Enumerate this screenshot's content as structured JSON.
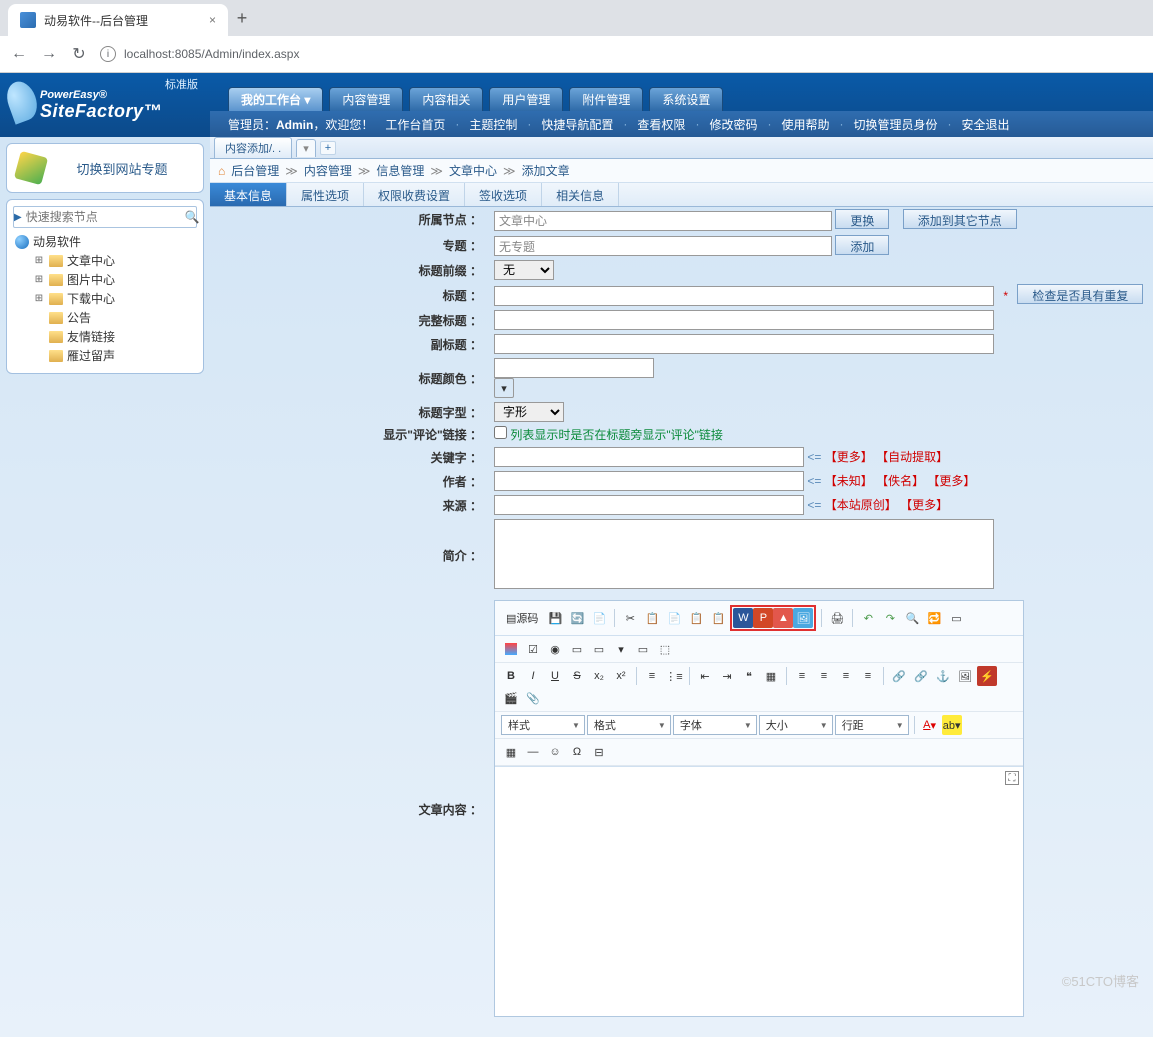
{
  "browser": {
    "tab_title": "动易软件--后台管理",
    "url": "localhost:8085/Admin/index.aspx"
  },
  "header": {
    "std_label": "标准版",
    "brand1": "PowerEasy®",
    "brand2": "SiteFactory™",
    "menu": [
      "我的工作台 ▾",
      "内容管理",
      "内容相关",
      "用户管理",
      "附件管理",
      "系统设置"
    ],
    "admin_prefix": "管理员：",
    "admin_name": "Admin",
    "welcome": "，欢迎您！",
    "links": [
      "工作台首页",
      "主题控制",
      "快捷导航配置",
      "查看权限",
      "修改密码",
      "使用帮助",
      "切换管理员身份",
      "安全退出"
    ]
  },
  "sidebar": {
    "switch_title": "切换到网站专题",
    "search_placeholder": "快速搜索节点",
    "root": "动易软件",
    "nodes": [
      "文章中心",
      "图片中心",
      "下载中心",
      "公告",
      "友情链接",
      "雁过留声"
    ]
  },
  "doc_tabs": {
    "active": "内容添加/. .",
    "add": "+"
  },
  "breadcrumb": [
    "后台管理",
    "内容管理",
    "信息管理",
    "文章中心",
    "添加文章"
  ],
  "form_tabs": [
    "基本信息",
    "属性选项",
    "权限收费设置",
    "签收选项",
    "相关信息"
  ],
  "form": {
    "node_label": "所属节点 ：",
    "node_value": "文章中心",
    "btn_change": "更换",
    "btn_addnode": "添加到其它节点",
    "topic_label": "专题 ：",
    "topic_value": "无专题",
    "btn_add": "添加",
    "prefix_label": "标题前缀 ：",
    "prefix_value": "无",
    "title_label": "标题 ：",
    "btn_checkdup": "检查是否具有重复",
    "fulltitle_label": "完整标题 ：",
    "subtitle_label": "副标题 ：",
    "titlecolor_label": "标题颜色 ：",
    "titlefont_label": "标题字型 ：",
    "titlefont_value": "字形",
    "comment_label": "显示\"评论\"链接 ：",
    "comment_hint": "列表显示时是否在标题旁显示\"评论\"链接",
    "keyword_label": "关键字 ：",
    "kw_more": "【更多】",
    "kw_auto": "【自动提取】",
    "author_label": "作者 ：",
    "au_unknown": "【未知】",
    "au_anon": "【佚名】",
    "au_more": "【更多】",
    "source_label": "来源 ：",
    "src_orig": "【本站原创】",
    "src_more": "【更多】",
    "intro_label": "简介 ：",
    "content_label": "文章内容 ："
  },
  "editor": {
    "source": "源码",
    "combos": {
      "style": "样式",
      "format": "格式",
      "font": "字体",
      "size": "大小",
      "lineheight": "行距"
    }
  },
  "watermark": "©51CTO博客"
}
